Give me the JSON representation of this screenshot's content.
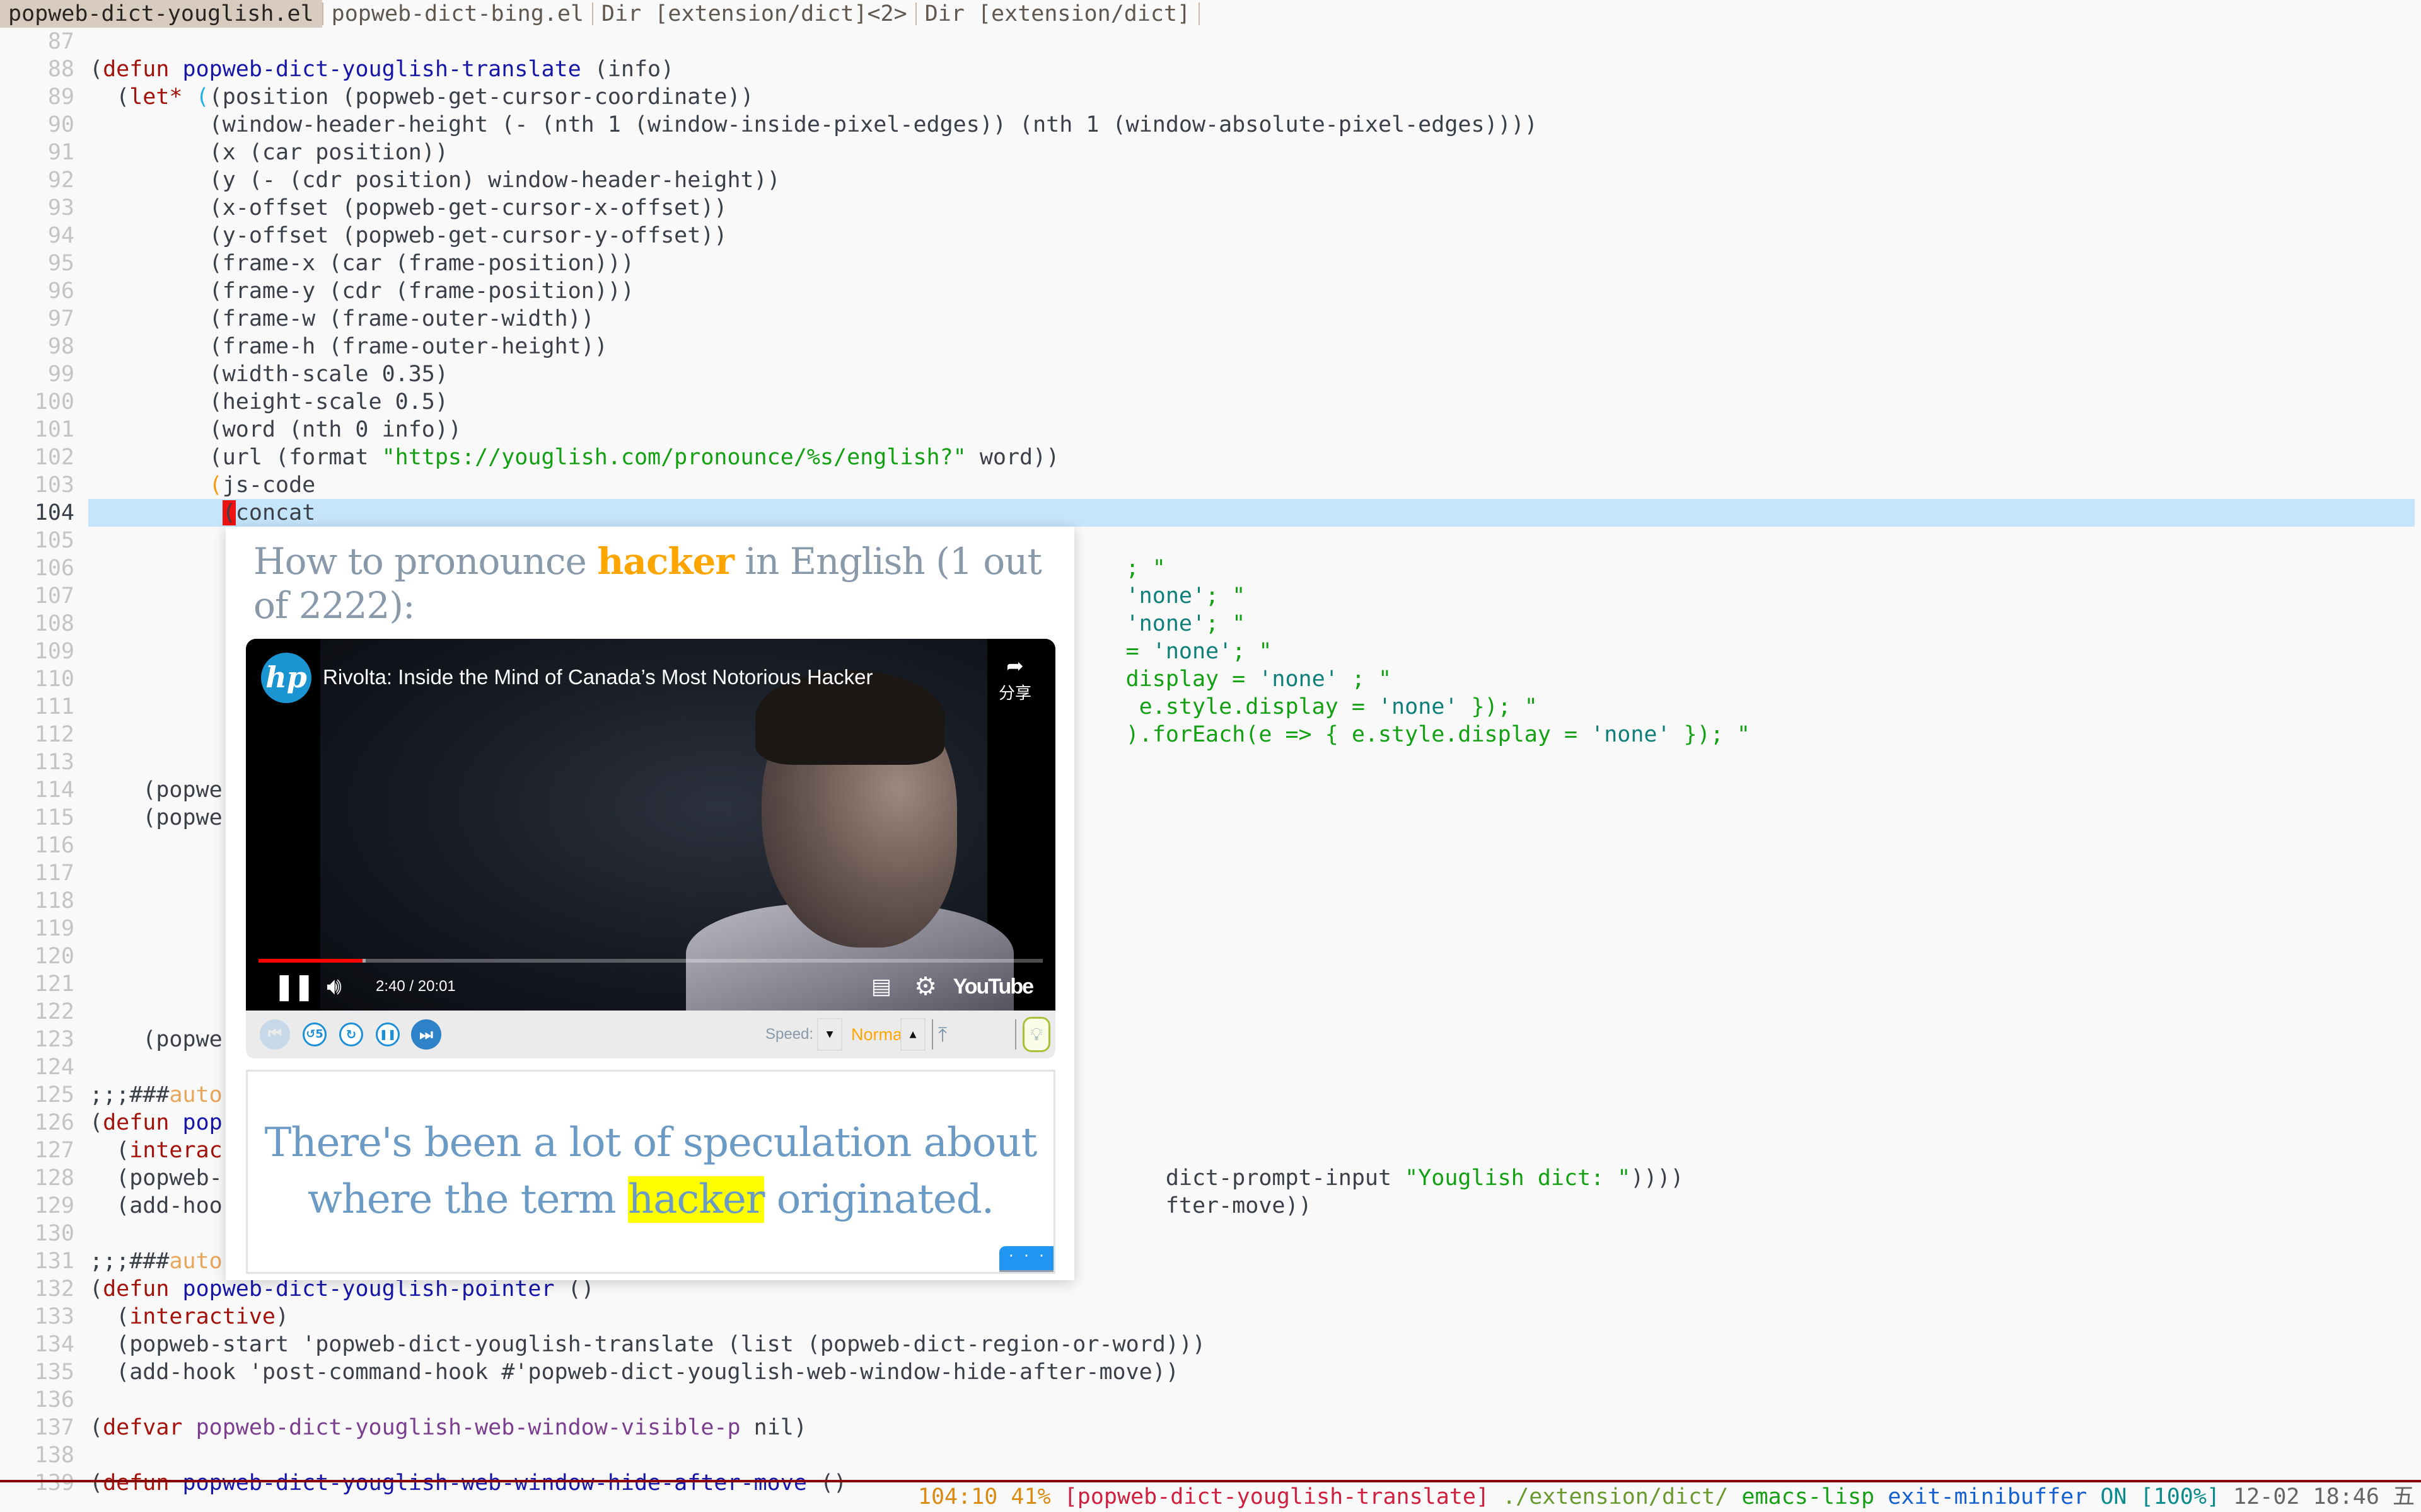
{
  "tabs": [
    {
      "label": "popweb-dict-youglish.el",
      "active": true
    },
    {
      "label": "popweb-dict-bing.el",
      "active": false
    },
    {
      "label": "Dir [extension/dict]<2>",
      "active": false
    },
    {
      "label": "Dir [extension/dict]",
      "active": false
    }
  ],
  "editor": {
    "current_line": 104,
    "lines": [
      {
        "n": "87",
        "segs": []
      },
      {
        "n": "88",
        "segs": [
          [
            "cm",
            "("
          ],
          [
            "kw",
            "defun"
          ],
          [
            "cm",
            " "
          ],
          [
            "fn",
            "popweb-dict-youglish-translate"
          ],
          [
            "cm",
            " (info)"
          ]
        ]
      },
      {
        "n": "89",
        "segs": [
          [
            "cm",
            "  ("
          ],
          [
            "kw",
            "let*"
          ],
          [
            "cm",
            " "
          ],
          [
            "par-cyan",
            "("
          ],
          [
            "cm",
            "(position (popweb-get-cursor-coordinate))"
          ]
        ]
      },
      {
        "n": "90",
        "segs": [
          [
            "cm",
            "         (window-header-height (- (nth 1 (window-inside-pixel-edges)) (nth 1 (window-absolute-pixel-edges))))"
          ]
        ]
      },
      {
        "n": "91",
        "segs": [
          [
            "cm",
            "         (x (car position))"
          ]
        ]
      },
      {
        "n": "92",
        "segs": [
          [
            "cm",
            "         (y (- (cdr position) window-header-height))"
          ]
        ]
      },
      {
        "n": "93",
        "segs": [
          [
            "cm",
            "         (x-offset (popweb-get-cursor-x-offset))"
          ]
        ]
      },
      {
        "n": "94",
        "segs": [
          [
            "cm",
            "         (y-offset (popweb-get-cursor-y-offset))"
          ]
        ]
      },
      {
        "n": "95",
        "segs": [
          [
            "cm",
            "         (frame-x (car (frame-position)))"
          ]
        ]
      },
      {
        "n": "96",
        "segs": [
          [
            "cm",
            "         (frame-y (cdr (frame-position)))"
          ]
        ]
      },
      {
        "n": "97",
        "segs": [
          [
            "cm",
            "         (frame-w (frame-outer-width))"
          ]
        ]
      },
      {
        "n": "98",
        "segs": [
          [
            "cm",
            "         (frame-h (frame-outer-height))"
          ]
        ]
      },
      {
        "n": "99",
        "segs": [
          [
            "cm",
            "         (width-scale 0.35)"
          ]
        ]
      },
      {
        "n": "100",
        "segs": [
          [
            "cm",
            "         (height-scale 0.5)"
          ]
        ]
      },
      {
        "n": "101",
        "segs": [
          [
            "cm",
            "         (word (nth 0 info))"
          ]
        ]
      },
      {
        "n": "102",
        "segs": [
          [
            "cm",
            "         (url (format "
          ],
          [
            "str",
            "\"https://youglish.com/pronounce/%s/english?\""
          ],
          [
            "cm",
            " word))"
          ]
        ]
      },
      {
        "n": "103",
        "segs": [
          [
            "cm",
            "         "
          ],
          [
            "par-orange",
            "("
          ],
          [
            "cm",
            "js-code"
          ]
        ]
      },
      {
        "n": "104",
        "segs": [
          [
            "cm",
            "          "
          ],
          [
            "cursor",
            "("
          ],
          [
            "cm",
            "concat"
          ]
        ]
      },
      {
        "n": "105",
        "segs": []
      },
      {
        "n": "106",
        "segs": [
          [
            "cm",
            "                                                                              "
          ],
          [
            "str",
            "; \""
          ]
        ]
      },
      {
        "n": "107",
        "segs": [
          [
            "cm",
            "                                                                              "
          ],
          [
            "str2",
            "'none'"
          ],
          [
            "str",
            "; \""
          ]
        ]
      },
      {
        "n": "108",
        "segs": [
          [
            "cm",
            "                                                                              "
          ],
          [
            "str2",
            "'none'"
          ],
          [
            "str",
            "; \""
          ]
        ]
      },
      {
        "n": "109",
        "segs": [
          [
            "cm",
            "                                                                              "
          ],
          [
            "str",
            "= "
          ],
          [
            "str2",
            "'none'"
          ],
          [
            "str",
            "; \""
          ]
        ]
      },
      {
        "n": "110",
        "segs": [
          [
            "cm",
            "                                                                              "
          ],
          [
            "str",
            "display = "
          ],
          [
            "str2",
            "'none'"
          ],
          [
            "str",
            " ; \""
          ]
        ]
      },
      {
        "n": "111",
        "segs": [
          [
            "cm",
            "                                                                              "
          ],
          [
            "str",
            " e.style.display = "
          ],
          [
            "str2",
            "'none'"
          ],
          [
            "str",
            " }); \""
          ]
        ]
      },
      {
        "n": "112",
        "segs": [
          [
            "cm",
            "                                                                              "
          ],
          [
            "str",
            ").forEach(e => { e.style.display = "
          ],
          [
            "str2",
            "'none'"
          ],
          [
            "str",
            " }); \""
          ]
        ]
      },
      {
        "n": "113",
        "segs": []
      },
      {
        "n": "114",
        "segs": [
          [
            "cm",
            "    (popwe"
          ]
        ]
      },
      {
        "n": "115",
        "segs": [
          [
            "cm",
            "    (popwe"
          ]
        ]
      },
      {
        "n": "116",
        "segs": []
      },
      {
        "n": "117",
        "segs": []
      },
      {
        "n": "118",
        "segs": []
      },
      {
        "n": "119",
        "segs": []
      },
      {
        "n": "120",
        "segs": []
      },
      {
        "n": "121",
        "segs": []
      },
      {
        "n": "122",
        "segs": []
      },
      {
        "n": "123",
        "segs": [
          [
            "cm",
            "    (popwe"
          ]
        ]
      },
      {
        "n": "124",
        "segs": []
      },
      {
        "n": "125",
        "segs": [
          [
            "cm",
            ";;;###"
          ],
          [
            "cmk",
            "auto"
          ]
        ]
      },
      {
        "n": "126",
        "segs": [
          [
            "cm",
            "("
          ],
          [
            "kw",
            "defun"
          ],
          [
            "cm",
            " "
          ],
          [
            "fn",
            "pop"
          ]
        ]
      },
      {
        "n": "127",
        "segs": [
          [
            "cm",
            "  ("
          ],
          [
            "kw",
            "interac"
          ]
        ]
      },
      {
        "n": "128",
        "segs": [
          [
            "cm",
            "  (popweb-                                                                       dict-prompt-input "
          ],
          [
            "str",
            "\"Youglish dict: \""
          ],
          [
            "cm",
            "))))"
          ]
        ]
      },
      {
        "n": "129",
        "segs": [
          [
            "cm",
            "  (add-hoo                                                                       fter-move))"
          ]
        ]
      },
      {
        "n": "130",
        "segs": []
      },
      {
        "n": "131",
        "segs": [
          [
            "cm",
            ";;;###"
          ],
          [
            "cmk",
            "auto"
          ]
        ]
      },
      {
        "n": "132",
        "segs": [
          [
            "cm",
            "("
          ],
          [
            "kw",
            "defun"
          ],
          [
            "cm",
            " "
          ],
          [
            "fn",
            "popweb-dict-youglish-pointer"
          ],
          [
            "cm",
            " ()"
          ]
        ]
      },
      {
        "n": "133",
        "segs": [
          [
            "cm",
            "  ("
          ],
          [
            "kw",
            "interactive"
          ],
          [
            "cm",
            ")"
          ]
        ]
      },
      {
        "n": "134",
        "segs": [
          [
            "cm",
            "  (popweb-start 'popweb-dict-youglish-translate (list (popweb-dict-region-or-word)))"
          ]
        ]
      },
      {
        "n": "135",
        "segs": [
          [
            "cm",
            "  (add-hook 'post-command-hook #'popweb-dict-youglish-web-window-hide-after-move))"
          ]
        ]
      },
      {
        "n": "136",
        "segs": []
      },
      {
        "n": "137",
        "segs": [
          [
            "cm",
            "("
          ],
          [
            "kw",
            "defvar"
          ],
          [
            "cm",
            " "
          ],
          [
            "var",
            "popweb-dict-youglish-web-window-visible-p"
          ],
          [
            "cm",
            " nil)"
          ]
        ]
      },
      {
        "n": "138",
        "segs": []
      },
      {
        "n": "139",
        "segs": [
          [
            "cm",
            "("
          ],
          [
            "kw",
            "defun"
          ],
          [
            "cm",
            " "
          ],
          [
            "fn",
            "popweb-dict-youglish-web-window-hide-after-move"
          ],
          [
            "cm",
            " ()"
          ]
        ]
      }
    ]
  },
  "popup": {
    "title_prefix": "How to pronounce ",
    "title_word": "hacker",
    "title_suffix": " in English (1 out of 2222):",
    "video": {
      "channel_logo_text": "hp",
      "title": "Rivolta: Inside the Mind of Canada’s Most Notorious Hacker",
      "share_label": "分享",
      "time": "2:40 / 20:01",
      "progress": 0.133,
      "buffered": 0.137,
      "brand": "YouTube"
    },
    "toolbar": {
      "speed_label": "Speed:",
      "speed_value": "Normal"
    },
    "caption": {
      "before": "There's been a lot of speculation about where the term ",
      "word": "hacker",
      "after": " originated.",
      "more_label": "· · ·"
    }
  },
  "modeline": {
    "position": "104:10",
    "percent": "41%",
    "function": "[popweb-dict-youglish-translate]",
    "directory": "./extension/dict/",
    "mode": "emacs-lisp",
    "last_command": "exit-minibuffer",
    "status": "ON",
    "battery": "[100%]",
    "datetime": "12-02 18:46",
    "weekday": "五"
  },
  "colors": {
    "current_line_bg": "#c5e5fb",
    "keyword": "#a3120a",
    "function_name": "#1616a8",
    "string": "#13a113",
    "youtube_red": "#ff0000",
    "highlight_word": "#ffff00",
    "accent_orange": "#ffa500"
  }
}
